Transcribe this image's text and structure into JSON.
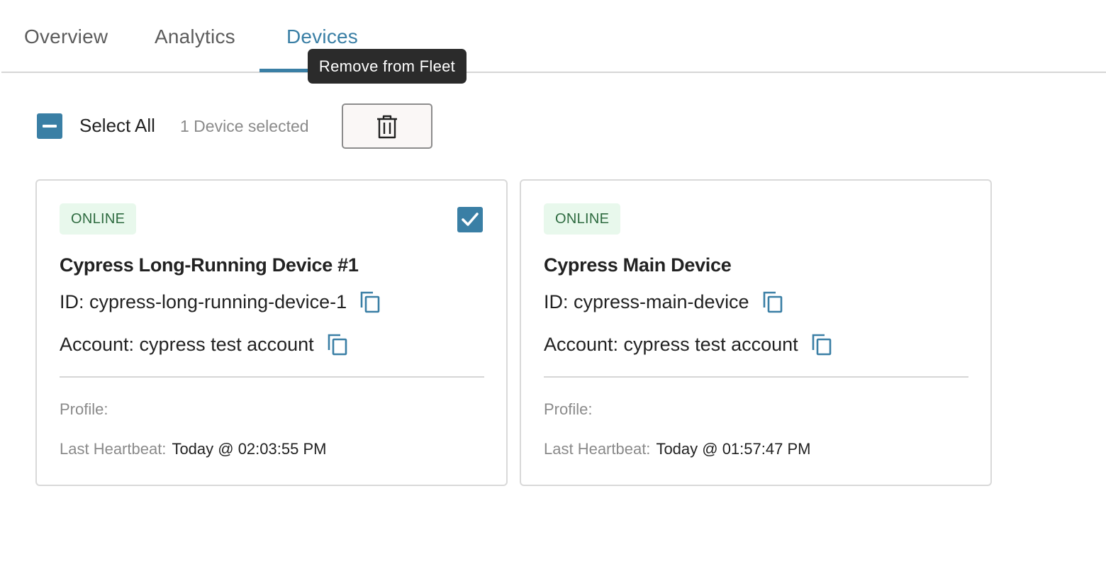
{
  "tabs": [
    {
      "label": "Overview",
      "active": false
    },
    {
      "label": "Analytics",
      "active": false
    },
    {
      "label": "Devices",
      "active": true
    }
  ],
  "tooltip": "Remove from Fleet",
  "toolbar": {
    "select_all_label": "Select All",
    "selected_count": "1 Device selected",
    "delete_icon": "trash-icon"
  },
  "colors": {
    "accent": "#3a7fa5",
    "online_badge_bg": "#e8f8ec",
    "online_badge_text": "#2e6b40",
    "tooltip_bg": "#2b2b2b"
  },
  "devices": [
    {
      "status": "ONLINE",
      "name": "Cypress Long-Running Device #1",
      "id_text": "ID: cypress-long-running-device-1",
      "account_text": "Account: cypress test account",
      "profile_label": "Profile:",
      "heartbeat_label": "Last Heartbeat:",
      "heartbeat_value": "Today @ 02:03:55 PM",
      "selected": true
    },
    {
      "status": "ONLINE",
      "name": "Cypress Main Device",
      "id_text": "ID: cypress-main-device",
      "account_text": "Account: cypress test account",
      "profile_label": "Profile:",
      "heartbeat_label": "Last Heartbeat:",
      "heartbeat_value": "Today @ 01:57:47 PM",
      "selected": false
    }
  ]
}
